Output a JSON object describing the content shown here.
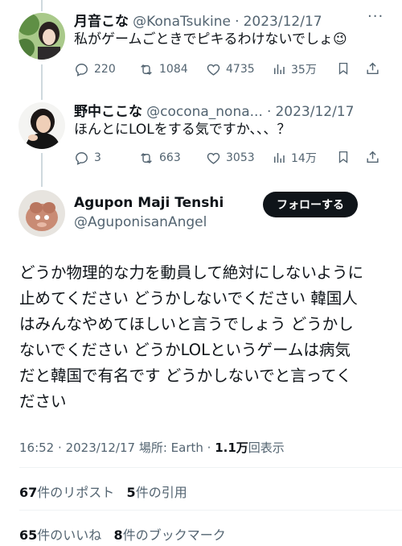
{
  "reply1": {
    "name": "月音こな",
    "handle": "@KonaTsukine",
    "dot": "·",
    "date": "2023/12/17",
    "text": "私がゲームごときでピキるわけないでしょ",
    "emoji": "😉",
    "more": "···",
    "replies": "220",
    "reposts": "1084",
    "likes": "4735",
    "views": "35万"
  },
  "reply2": {
    "name": "野中ここな",
    "handle": "@cocona_nona...",
    "dot": "·",
    "date": "2023/12/17",
    "text": "ほんとにLOLをする気ですか、、、？",
    "replies": "3",
    "reposts": "663",
    "likes": "3053",
    "views": "14万"
  },
  "main": {
    "name": "Agupon Maji Tenshi",
    "handle": "@AguponisanAngel",
    "follow_label": "フォローする",
    "text": "どうか物理的な力を動員して絶対にしないように\n止めてください どうかしないでください 韓国人\nはみんなやめてほしいと言うでしょう どうかし\nないでください どうかLOLというゲームは病気\nだと韓国で有名です どうかしないでと言ってく\nださい",
    "time": "16:52",
    "dot": "·",
    "date": "2023/12/17",
    "location": "場所: Earth",
    "dot2": "·",
    "views_count": "1.1万",
    "views_label": "回表示",
    "reposts_count": "67",
    "reposts_label": "件のリポスト",
    "quotes_count": "5",
    "quotes_label": "件の引用",
    "likes_count": "65",
    "likes_label": "件のいいね",
    "bookmarks_count": "8",
    "bookmarks_label": "件のブックマーク"
  },
  "colors": {
    "text": "#0f1419",
    "secondary": "#536471",
    "line": "#cfd9de",
    "button": "#0f1419"
  }
}
